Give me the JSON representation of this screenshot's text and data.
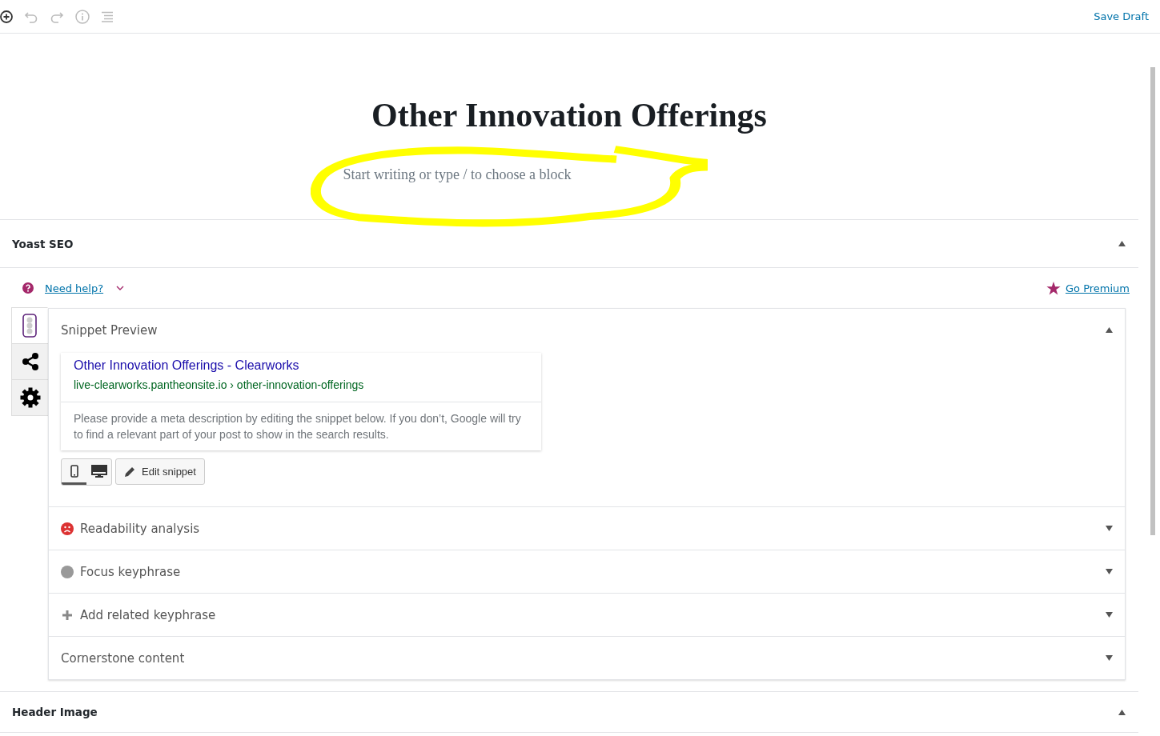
{
  "toolbar": {
    "save_label": "Save Draft"
  },
  "editor": {
    "title": "Other Innovation Offerings",
    "placeholder": "Start writing or type / to choose a block",
    "highlighted": true
  },
  "yoast": {
    "title": "Yoast SEO",
    "expanded": true,
    "help_label": "Need help?",
    "premium_label": "Go Premium",
    "side_tabs": [
      {
        "kind": "traffic-light",
        "selected": true
      },
      {
        "kind": "share",
        "selected": false
      },
      {
        "kind": "gear",
        "selected": false
      }
    ],
    "sections": [
      {
        "kind": "snippet",
        "label": "Snippet Preview",
        "expanded": true
      },
      {
        "kind": "sad-face",
        "label": "Readability analysis",
        "expanded": false
      },
      {
        "kind": "dot",
        "label": "Focus keyphrase",
        "expanded": false
      },
      {
        "kind": "plus",
        "label": "Add related keyphrase",
        "expanded": false
      },
      {
        "kind": "none",
        "label": "Cornerstone content",
        "expanded": false
      }
    ],
    "snippet": {
      "title": "Other Innovation Offerings - Clearworks",
      "url": "live-clearworks.pantheonsite.io › other-innovation-offerings",
      "description": "Please provide a meta description by editing the snippet below. If you don’t, Google will try to find a relevant part of your post to show in the search results.",
      "devices": [
        {
          "kind": "mobile",
          "selected": true
        },
        {
          "kind": "desktop",
          "selected": false
        }
      ],
      "edit_label": "Edit snippet"
    }
  },
  "header_image": {
    "title": "Header Image",
    "expanded": true
  }
}
